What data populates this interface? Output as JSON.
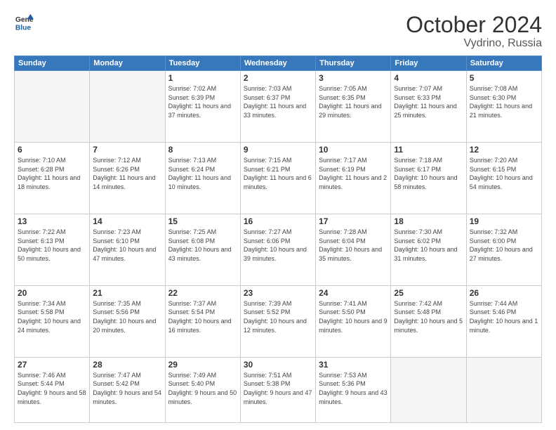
{
  "logo": {
    "general": "General",
    "blue": "Blue"
  },
  "header": {
    "month": "October 2024",
    "location": "Vydrino, Russia"
  },
  "weekdays": [
    "Sunday",
    "Monday",
    "Tuesday",
    "Wednesday",
    "Thursday",
    "Friday",
    "Saturday"
  ],
  "weeks": [
    [
      {
        "day": "",
        "info": ""
      },
      {
        "day": "",
        "info": ""
      },
      {
        "day": "1",
        "info": "Sunrise: 7:02 AM\nSunset: 6:39 PM\nDaylight: 11 hours and 37 minutes."
      },
      {
        "day": "2",
        "info": "Sunrise: 7:03 AM\nSunset: 6:37 PM\nDaylight: 11 hours and 33 minutes."
      },
      {
        "day": "3",
        "info": "Sunrise: 7:05 AM\nSunset: 6:35 PM\nDaylight: 11 hours and 29 minutes."
      },
      {
        "day": "4",
        "info": "Sunrise: 7:07 AM\nSunset: 6:33 PM\nDaylight: 11 hours and 25 minutes."
      },
      {
        "day": "5",
        "info": "Sunrise: 7:08 AM\nSunset: 6:30 PM\nDaylight: 11 hours and 21 minutes."
      }
    ],
    [
      {
        "day": "6",
        "info": "Sunrise: 7:10 AM\nSunset: 6:28 PM\nDaylight: 11 hours and 18 minutes."
      },
      {
        "day": "7",
        "info": "Sunrise: 7:12 AM\nSunset: 6:26 PM\nDaylight: 11 hours and 14 minutes."
      },
      {
        "day": "8",
        "info": "Sunrise: 7:13 AM\nSunset: 6:24 PM\nDaylight: 11 hours and 10 minutes."
      },
      {
        "day": "9",
        "info": "Sunrise: 7:15 AM\nSunset: 6:21 PM\nDaylight: 11 hours and 6 minutes."
      },
      {
        "day": "10",
        "info": "Sunrise: 7:17 AM\nSunset: 6:19 PM\nDaylight: 11 hours and 2 minutes."
      },
      {
        "day": "11",
        "info": "Sunrise: 7:18 AM\nSunset: 6:17 PM\nDaylight: 10 hours and 58 minutes."
      },
      {
        "day": "12",
        "info": "Sunrise: 7:20 AM\nSunset: 6:15 PM\nDaylight: 10 hours and 54 minutes."
      }
    ],
    [
      {
        "day": "13",
        "info": "Sunrise: 7:22 AM\nSunset: 6:13 PM\nDaylight: 10 hours and 50 minutes."
      },
      {
        "day": "14",
        "info": "Sunrise: 7:23 AM\nSunset: 6:10 PM\nDaylight: 10 hours and 47 minutes."
      },
      {
        "day": "15",
        "info": "Sunrise: 7:25 AM\nSunset: 6:08 PM\nDaylight: 10 hours and 43 minutes."
      },
      {
        "day": "16",
        "info": "Sunrise: 7:27 AM\nSunset: 6:06 PM\nDaylight: 10 hours and 39 minutes."
      },
      {
        "day": "17",
        "info": "Sunrise: 7:28 AM\nSunset: 6:04 PM\nDaylight: 10 hours and 35 minutes."
      },
      {
        "day": "18",
        "info": "Sunrise: 7:30 AM\nSunset: 6:02 PM\nDaylight: 10 hours and 31 minutes."
      },
      {
        "day": "19",
        "info": "Sunrise: 7:32 AM\nSunset: 6:00 PM\nDaylight: 10 hours and 27 minutes."
      }
    ],
    [
      {
        "day": "20",
        "info": "Sunrise: 7:34 AM\nSunset: 5:58 PM\nDaylight: 10 hours and 24 minutes."
      },
      {
        "day": "21",
        "info": "Sunrise: 7:35 AM\nSunset: 5:56 PM\nDaylight: 10 hours and 20 minutes."
      },
      {
        "day": "22",
        "info": "Sunrise: 7:37 AM\nSunset: 5:54 PM\nDaylight: 10 hours and 16 minutes."
      },
      {
        "day": "23",
        "info": "Sunrise: 7:39 AM\nSunset: 5:52 PM\nDaylight: 10 hours and 12 minutes."
      },
      {
        "day": "24",
        "info": "Sunrise: 7:41 AM\nSunset: 5:50 PM\nDaylight: 10 hours and 9 minutes."
      },
      {
        "day": "25",
        "info": "Sunrise: 7:42 AM\nSunset: 5:48 PM\nDaylight: 10 hours and 5 minutes."
      },
      {
        "day": "26",
        "info": "Sunrise: 7:44 AM\nSunset: 5:46 PM\nDaylight: 10 hours and 1 minute."
      }
    ],
    [
      {
        "day": "27",
        "info": "Sunrise: 7:46 AM\nSunset: 5:44 PM\nDaylight: 9 hours and 58 minutes."
      },
      {
        "day": "28",
        "info": "Sunrise: 7:47 AM\nSunset: 5:42 PM\nDaylight: 9 hours and 54 minutes."
      },
      {
        "day": "29",
        "info": "Sunrise: 7:49 AM\nSunset: 5:40 PM\nDaylight: 9 hours and 50 minutes."
      },
      {
        "day": "30",
        "info": "Sunrise: 7:51 AM\nSunset: 5:38 PM\nDaylight: 9 hours and 47 minutes."
      },
      {
        "day": "31",
        "info": "Sunrise: 7:53 AM\nSunset: 5:36 PM\nDaylight: 9 hours and 43 minutes."
      },
      {
        "day": "",
        "info": ""
      },
      {
        "day": "",
        "info": ""
      }
    ]
  ]
}
